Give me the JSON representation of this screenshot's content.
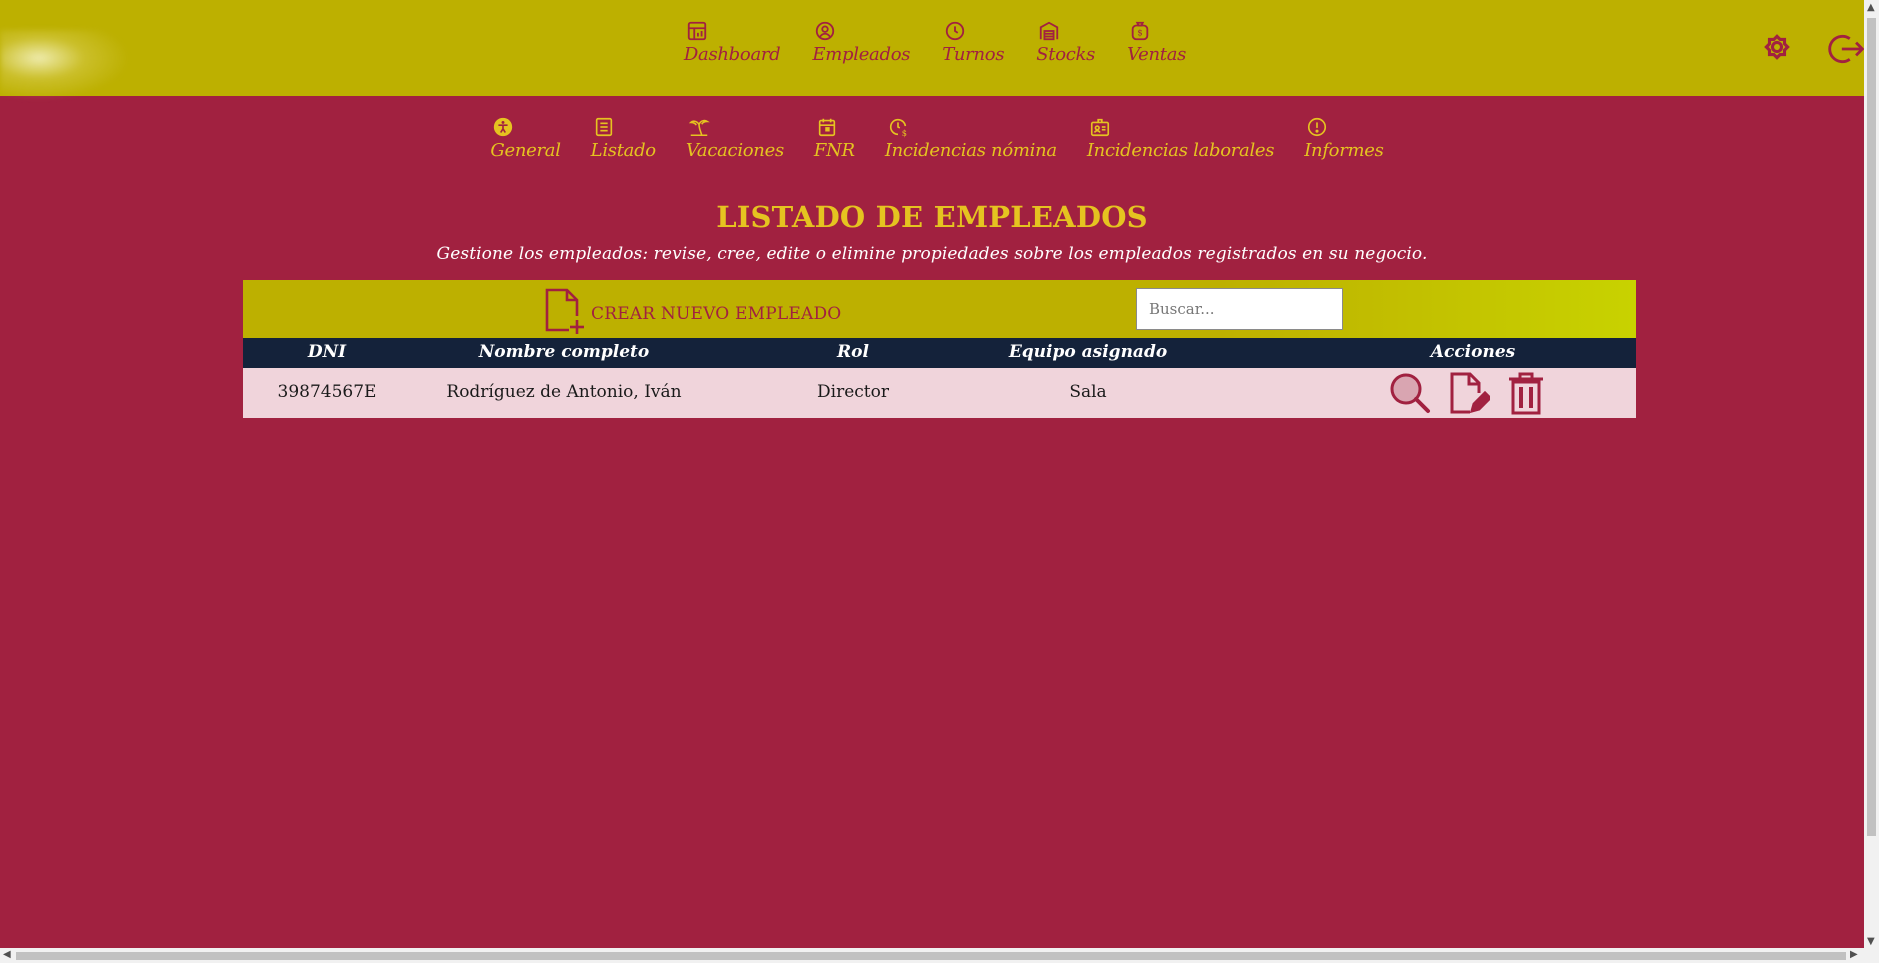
{
  "main_nav": [
    {
      "label": "Dashboard",
      "icon": "dashboard-icon"
    },
    {
      "label": "Empleados",
      "icon": "user-circle-icon"
    },
    {
      "label": "Turnos",
      "icon": "clock-icon"
    },
    {
      "label": "Stocks",
      "icon": "warehouse-icon"
    },
    {
      "label": "Ventas",
      "icon": "money-bag-icon"
    }
  ],
  "sub_nav": [
    {
      "label": "General",
      "icon": "accessibility-icon"
    },
    {
      "label": "Listado",
      "icon": "list-icon"
    },
    {
      "label": "Vacaciones",
      "icon": "palm-tree-icon"
    },
    {
      "label": "FNR",
      "icon": "calendar-icon"
    },
    {
      "label": "Incidencias nómina",
      "icon": "clock-dollar-icon"
    },
    {
      "label": "Incidencias laborales",
      "icon": "id-badge-icon"
    },
    {
      "label": "Informes",
      "icon": "alert-circle-icon"
    }
  ],
  "page": {
    "title": "LISTADO DE EMPLEADOS",
    "subtitle": "Gestione los empleados: revise, cree, edite o elimine propiedades sobre los empleados registrados en su negocio."
  },
  "toolbar": {
    "create_label": "CREAR NUEVO EMPLEADO",
    "search_placeholder": "Buscar..."
  },
  "table": {
    "headers": {
      "dni": "DNI",
      "name": "Nombre completo",
      "rol": "Rol",
      "team": "Equipo asignado",
      "actions": "Acciones"
    },
    "rows": [
      {
        "dni": "39874567E",
        "name": "Rodríguez de Antonio, Iván",
        "rol": "Director",
        "team": "Sala"
      }
    ]
  },
  "colors": {
    "header_bg": "#bdb000",
    "page_bg": "#a12140",
    "accent_text": "#e5c320",
    "table_header_bg": "#14223a",
    "row_bg": "#f0d4db"
  }
}
